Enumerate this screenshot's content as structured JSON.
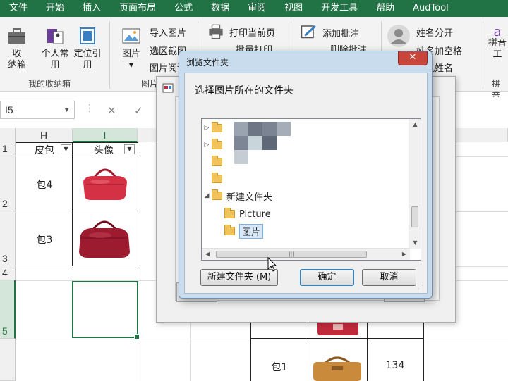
{
  "ribbon_tabs": [
    "文件",
    "开始",
    "插入",
    "页面布局",
    "公式",
    "数据",
    "审阅",
    "视图",
    "开发工具",
    "帮助",
    "AudTool"
  ],
  "ribbon": {
    "btn_toolbox": "收\n纳箱",
    "btn_personal": "个人常\n用",
    "btn_locate": "定位引\n用",
    "group_toolbox": "我的收纳箱",
    "btn_picture": "图片",
    "import_picture": "导入图片",
    "region_screenshot": "选区截图",
    "picture_reading": "图片阅读",
    "group_picture": "图片",
    "print_current": "打印当前页",
    "batch_print": "批量打印",
    "add_comment": "添加批注",
    "delete_comment": "删除批注",
    "split_name": "姓名分开",
    "name_add_space": "姓名加空格",
    "random_name": "随机姓名",
    "btn_pinyin": "拼音\n工",
    "group_pinyin": "拼音"
  },
  "formula_bar": {
    "cell_ref": "I5",
    "cancel": "✕",
    "confirm": "✓"
  },
  "columns": [
    "H",
    "I"
  ],
  "rows": [
    "1",
    "2",
    "3",
    "4",
    "5"
  ],
  "cells": {
    "h1": "皮包",
    "i1": "头像",
    "h2": "包4",
    "h3": "包3",
    "bottom_label": "包1",
    "bottom_value": "134"
  },
  "dialog": {
    "title": "浏览文件夹",
    "prompt": "选择图片所在的文件夹",
    "tree": [
      {
        "label": "新建文件夹",
        "level": 0,
        "expanded": true
      },
      {
        "label": "Picture",
        "level": 1
      },
      {
        "label": "图片",
        "level": 1,
        "selected": true
      }
    ],
    "new_folder_button": "新建文件夹 (M)",
    "ok_button": "确定",
    "cancel_button": "取消",
    "close_glyph": "✕"
  },
  "colors": {
    "accent": "#217346",
    "close_red": "#c8453c",
    "bag_red": "#c02b3c"
  }
}
